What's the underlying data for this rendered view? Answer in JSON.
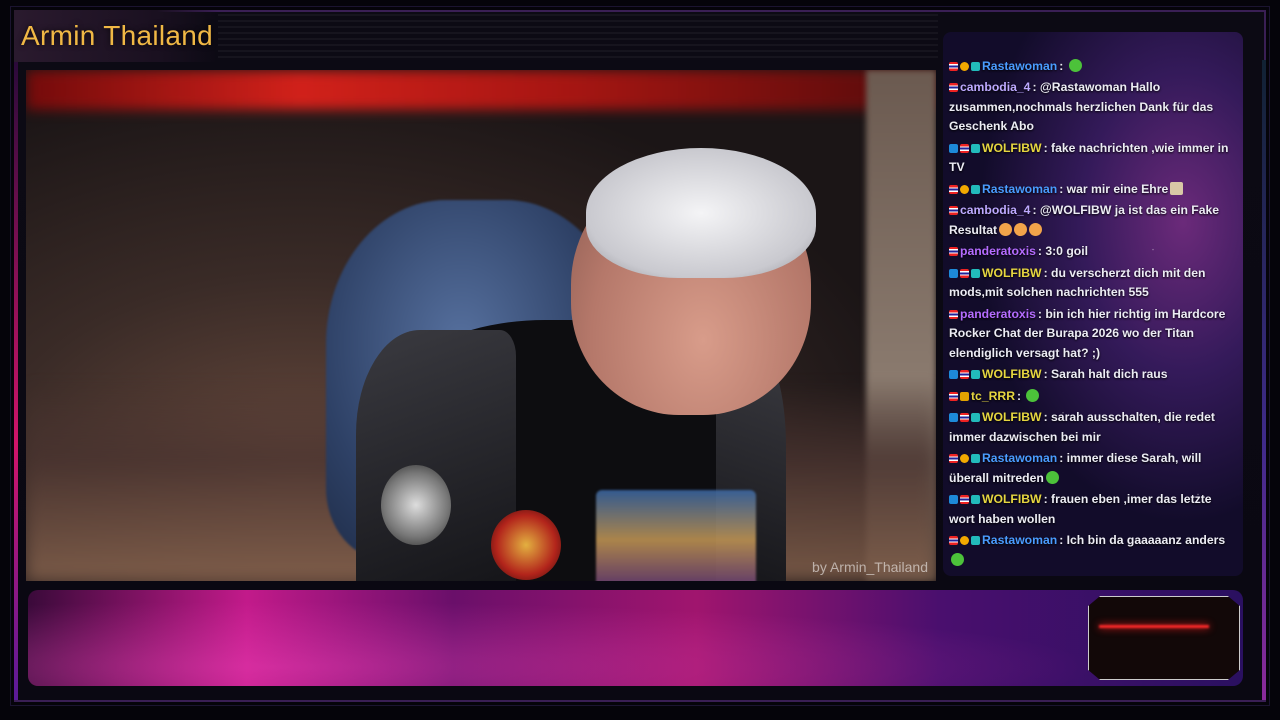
{
  "stream": {
    "channel_title": "Armin Thailand",
    "watermark": "by Armin_Thailand"
  },
  "chat": {
    "messages": [
      {
        "user": "Rastawoman",
        "color": "#4a9cff",
        "badges": [
          "flag",
          "one",
          "gm"
        ],
        "text": "",
        "emote": "green"
      },
      {
        "user": "cambodia_4",
        "color": "#bda9ff",
        "badges": [
          "flag"
        ],
        "text": "@Rastawoman Hallo zusammen,nochmals herzlichen Dank für das Geschenk Abo"
      },
      {
        "user": "WOLFIBW",
        "color": "#e6d640",
        "badges": [
          "blue",
          "flag",
          "gm"
        ],
        "text": "fake nachrichten ,wie immer in TV"
      },
      {
        "user": "Rastawoman",
        "color": "#4a9cff",
        "badges": [
          "flag",
          "one",
          "gm"
        ],
        "text": "war mir eine Ehre",
        "emote": "img"
      },
      {
        "user": "cambodia_4",
        "color": "#bda9ff",
        "badges": [
          "flag"
        ],
        "text": "@WOLFIBW ja ist das ein Fake Resultat",
        "emote": "face3"
      },
      {
        "user": "panderatoxis",
        "color": "#b56cff",
        "badges": [
          "flag"
        ],
        "text": "3:0 goil"
      },
      {
        "user": "WOLFIBW",
        "color": "#e6d640",
        "badges": [
          "blue",
          "flag",
          "gm"
        ],
        "text": "du verscherzt dich mit den mods,mit solchen nachrichten 555"
      },
      {
        "user": "panderatoxis",
        "color": "#b56cff",
        "badges": [
          "flag"
        ],
        "text": "bin ich hier richtig im Hardcore Rocker Chat der Burapa 2026 wo der Titan elendiglich versagt hat? ;)"
      },
      {
        "user": "WOLFIBW",
        "color": "#e6d640",
        "badges": [
          "blue",
          "flag",
          "gm"
        ],
        "text": "Sarah halt dich raus"
      },
      {
        "user": "tc_RRR",
        "color": "#e6d640",
        "badges": [
          "flag",
          "gold"
        ],
        "text": "",
        "emote": "green"
      },
      {
        "user": "WOLFIBW",
        "color": "#e6d640",
        "badges": [
          "blue",
          "flag",
          "gm"
        ],
        "text": "sarah ausschalten, die redet immer dazwischen bei mir"
      },
      {
        "user": "Rastawoman",
        "color": "#4a9cff",
        "badges": [
          "flag",
          "one",
          "gm"
        ],
        "text": "immer diese Sarah, will überall mitreden",
        "emote": "green"
      },
      {
        "user": "WOLFIBW",
        "color": "#e6d640",
        "badges": [
          "blue",
          "flag",
          "gm"
        ],
        "text": "frauen eben ,imer das letzte wort haben wollen"
      },
      {
        "user": "Rastawoman",
        "color": "#4a9cff",
        "badges": [
          "flag",
          "one",
          "gm"
        ],
        "text": "Ich bin da gaaaaanz anders",
        "emote": "green"
      }
    ]
  },
  "colors": {
    "title": "#f0b845",
    "chat_text": "#ececf4"
  }
}
